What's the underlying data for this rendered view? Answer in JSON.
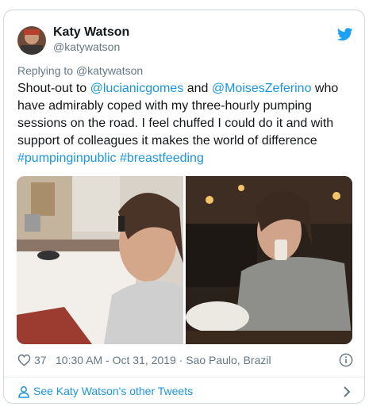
{
  "tweet": {
    "author": {
      "name": "Katy Watson",
      "handle": "@katywatson",
      "avatar_icon": "profile-photo"
    },
    "platform_icon": "twitter-bird-icon",
    "reply_context": "Replying to @katywatson",
    "text": {
      "part1": "Shout-out to ",
      "mention1": "@lucianicgomes",
      "part2": " and ",
      "mention2": "@MoisesZeferino",
      "part3": " who have admirably coped with my three-hourly pumping sessions on the road. I feel chuffed I could do it and with support of colleagues it makes the world of difference ",
      "hashtag1": "#pumpinginpublic",
      "part4": " ",
      "hashtag2": "#breastfeeding"
    },
    "likes": "37",
    "timestamp": "10:30 AM - Oct 31, 2019 · Sao Paulo, Brazil",
    "footer_link": "See Katy Watson's other Tweets",
    "colors": {
      "link": "#1b95e0",
      "text": "#14171a",
      "muted": "#657786",
      "border": "#cfd9de"
    }
  }
}
